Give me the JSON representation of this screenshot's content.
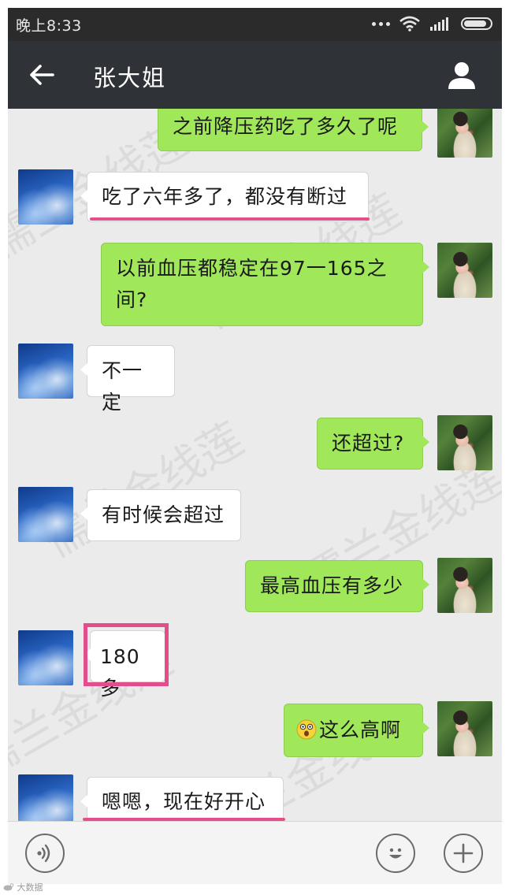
{
  "status_bar": {
    "time": "晚上8:33"
  },
  "header": {
    "title": "张大姐"
  },
  "messages": [
    {
      "side": "right",
      "text": "之前降压药吃了多久了呢"
    },
    {
      "side": "left",
      "text": "吃了六年多了，都没有断过",
      "marked": "underline"
    },
    {
      "side": "right",
      "lines": [
        "以前血压都稳定在97一165之",
        "间?"
      ]
    },
    {
      "side": "left",
      "text": "不一定"
    },
    {
      "side": "right",
      "text": "还超过?"
    },
    {
      "side": "left",
      "text": "有时候会超过"
    },
    {
      "side": "right",
      "text": "最高血压有多少"
    },
    {
      "side": "left",
      "text": "180多",
      "marked": "box"
    },
    {
      "side": "right",
      "text": "这么高啊",
      "emoji": "surprised-face-icon"
    },
    {
      "side": "left",
      "text": "嗯嗯，现在好开心",
      "marked": "underline"
    }
  ],
  "watermark": {
    "text": "儒兰金线莲"
  },
  "credit": {
    "text": "大数据"
  },
  "colors": {
    "sent_bubble": "#a0e75a",
    "received_bubble": "#ffffff",
    "header_bg": "#2f3236",
    "status_bg": "#2b2b2b",
    "annotation": "#e24d8a"
  },
  "icons": {
    "back": "arrow-left-icon",
    "profile": "person-icon",
    "voice": "voice-icon",
    "emoji": "emoji-smile-icon",
    "more": "plus-icon"
  }
}
